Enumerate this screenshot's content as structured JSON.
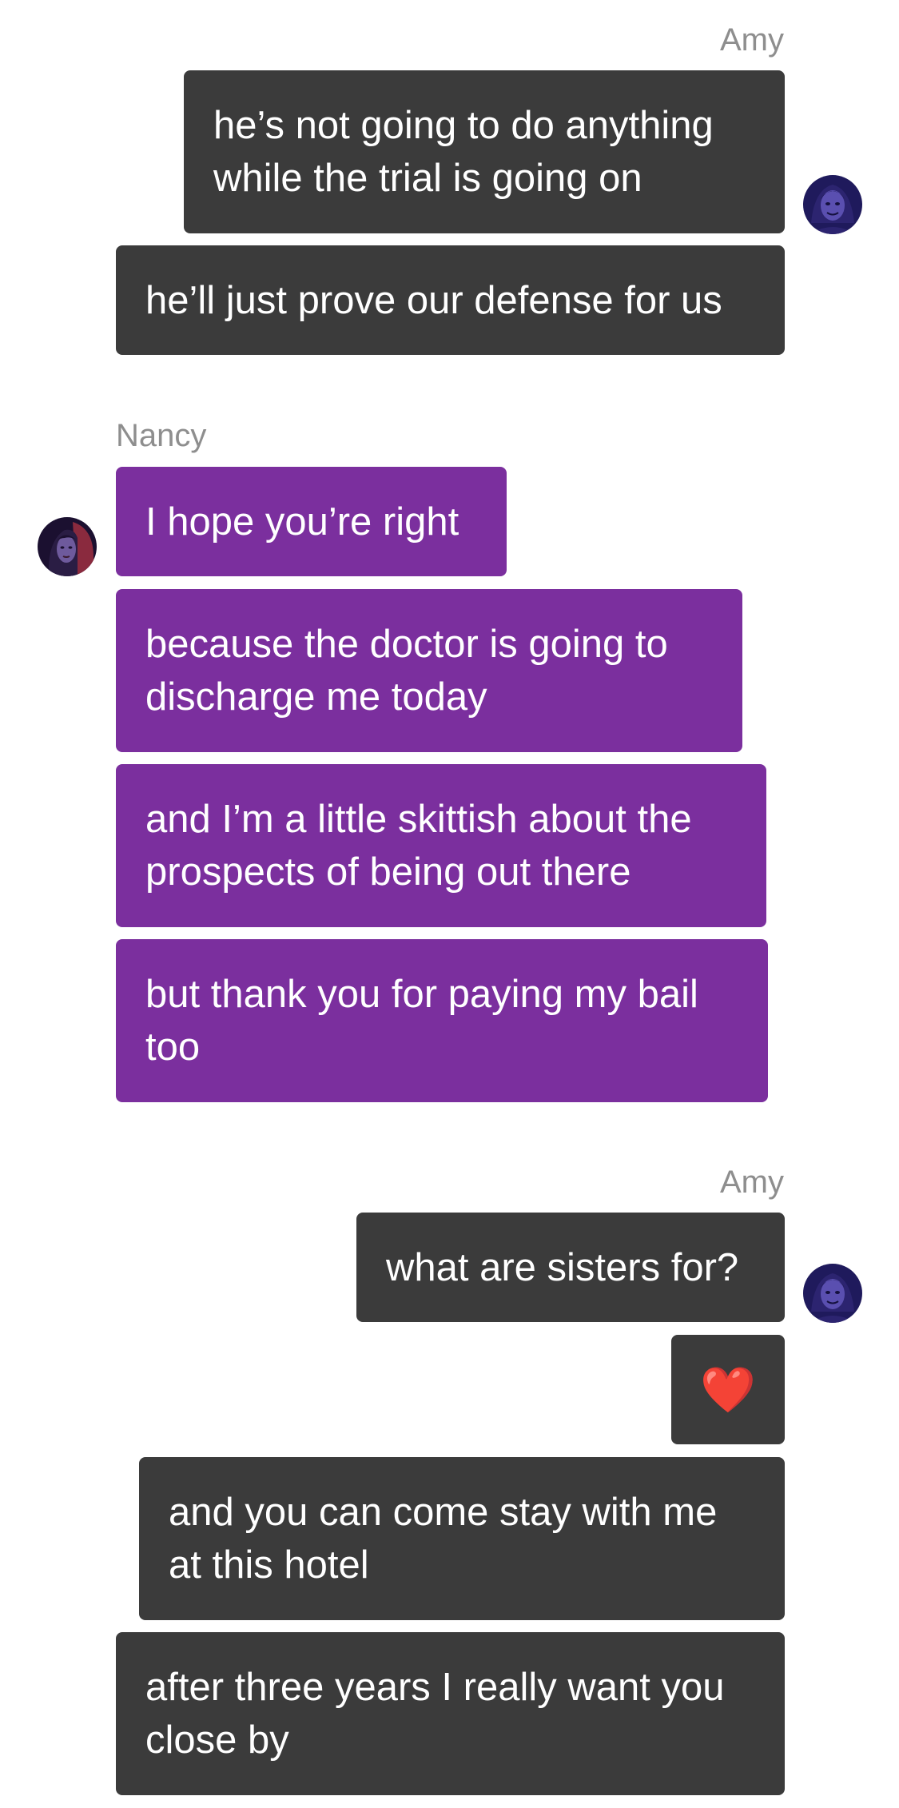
{
  "conversation": {
    "group1": {
      "sender": "Amy",
      "avatar_icon": "amy-avatar-icon",
      "messages": [
        "he’s not going to do anything\nwhile the trial is going on",
        "he’ll just prove our defense for us"
      ]
    },
    "group2": {
      "sender": "Nancy",
      "avatar_icon": "nancy-avatar-icon",
      "messages": [
        "I hope you’re right",
        "because the doctor is going to\ndischarge me today",
        "and I’m a little skittish about the\nprospects of being out there",
        "but thank you for paying my bail\ntoo"
      ]
    },
    "group3": {
      "sender": "Amy",
      "avatar_icon": "amy-avatar-icon",
      "messages": [
        "what are sisters for?",
        "❤️",
        "and you can come stay with me\nat this hotel",
        "after three years I really want you\nclose by"
      ]
    }
  },
  "colors": {
    "amy_bubble": "#3b3b3b",
    "nancy_bubble": "#7b2f9e",
    "sender_name": "#8e8e8e",
    "background": "#ffffff"
  }
}
